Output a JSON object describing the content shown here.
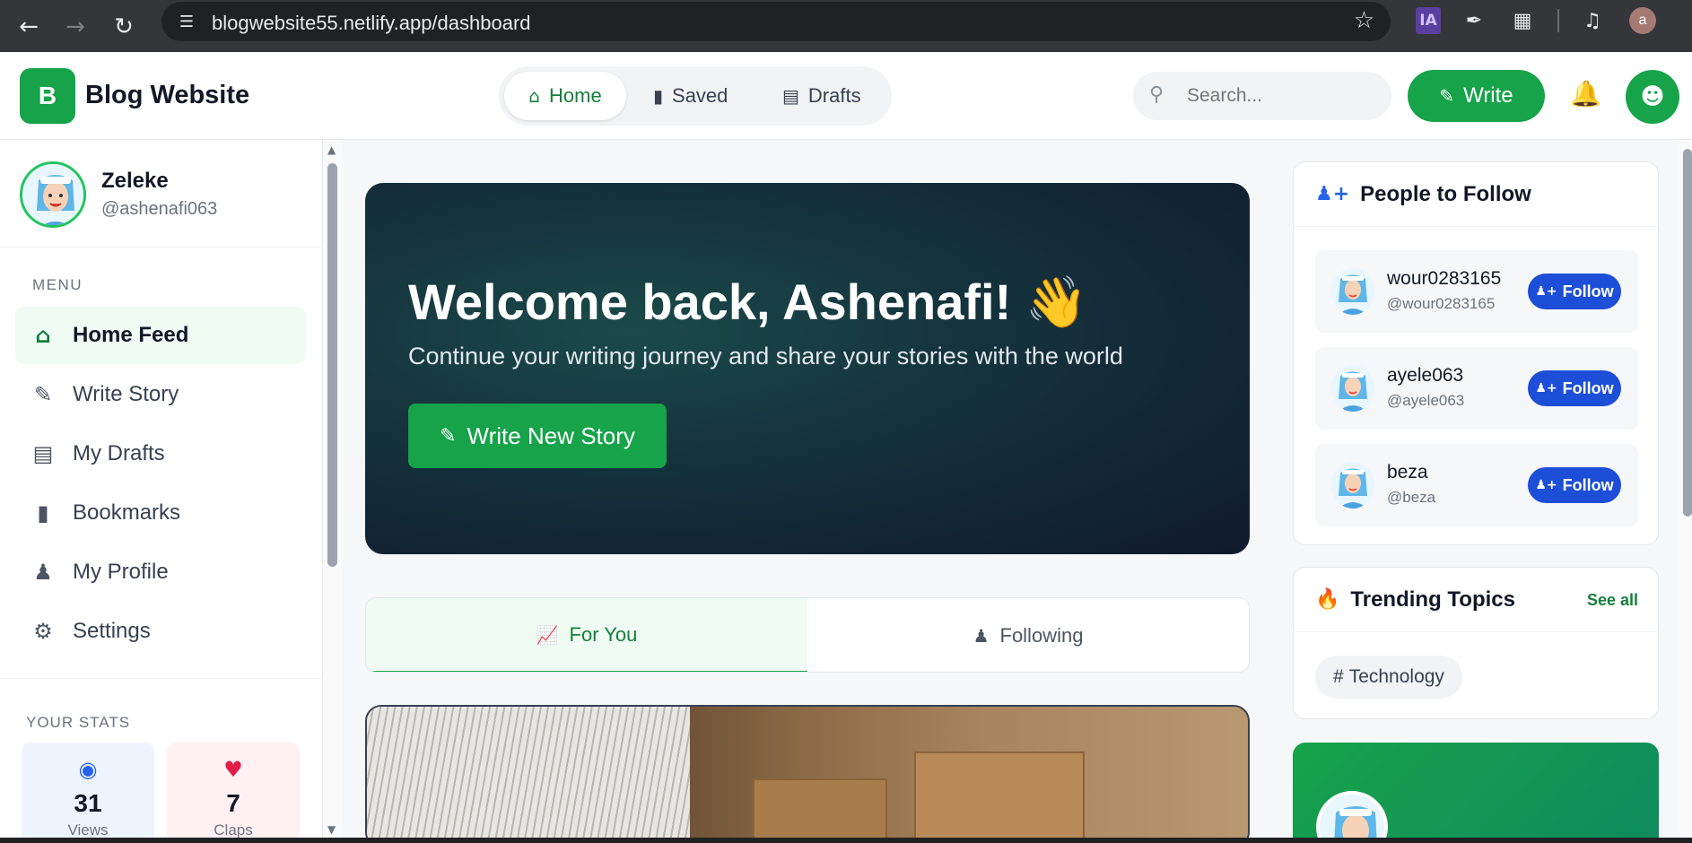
{
  "browser": {
    "url": "blogwebsite55.netlify.app/dashboard",
    "back_icon": "arrow-left-icon",
    "extension_ia": "IA",
    "profile_initial": "a"
  },
  "header": {
    "logo_letter": "B",
    "brand": "Blog Website",
    "tabs": [
      {
        "label": "Home",
        "icon": "home-icon"
      },
      {
        "label": "Saved",
        "icon": "bookmark-icon"
      },
      {
        "label": "Drafts",
        "icon": "file-icon"
      }
    ],
    "search_placeholder": "Search...",
    "write_label": "Write"
  },
  "sidebar": {
    "user_name": "Zeleke",
    "user_handle": "@ashenafi063",
    "menu_label": "MENU",
    "menu": [
      {
        "label": "Home Feed",
        "icon": "home-icon"
      },
      {
        "label": "Write Story",
        "icon": "pen-icon"
      },
      {
        "label": "My Drafts",
        "icon": "file-icon"
      },
      {
        "label": "Bookmarks",
        "icon": "bookmark-icon"
      },
      {
        "label": "My Profile",
        "icon": "users-icon"
      },
      {
        "label": "Settings",
        "icon": "gear-icon"
      }
    ],
    "stats_label": "YOUR STATS",
    "stats": [
      {
        "value": "31",
        "label": "Views"
      },
      {
        "value": "7",
        "label": "Claps"
      }
    ]
  },
  "hero": {
    "title": "Welcome back, Ashenafi!",
    "subtitle": "Continue your writing journey and share your stories with the world",
    "cta": "Write New Story"
  },
  "feed_tabs": [
    {
      "label": "For You",
      "icon": "chart-line-icon"
    },
    {
      "label": "Following",
      "icon": "users-icon"
    }
  ],
  "people": {
    "title": "People to Follow",
    "follow_label": "Follow",
    "list": [
      {
        "name": "wour0283165",
        "handle": "@wour0283165"
      },
      {
        "name": "ayele063",
        "handle": "@ayele063"
      },
      {
        "name": "beza",
        "handle": "@beza"
      }
    ]
  },
  "trending": {
    "title": "Trending Topics",
    "see_all": "See all",
    "topics": [
      "Technology"
    ]
  },
  "colors": {
    "primary_green": "#16a34a",
    "follow_blue": "#1d4ed8",
    "hero_dark": "#111a2e"
  }
}
